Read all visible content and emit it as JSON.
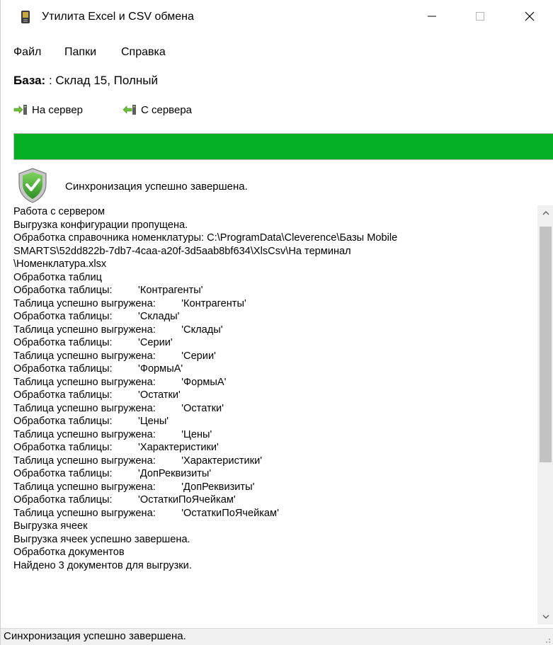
{
  "window": {
    "title": "Утилита Excel и CSV обмена"
  },
  "menu": {
    "items": [
      "Файл",
      "Папки",
      "Справка"
    ]
  },
  "database": {
    "label": "База:",
    "value": " : Склад 15, Полный"
  },
  "toolbar": {
    "to_server_label": "На сервер",
    "from_server_label": "С сервера"
  },
  "progress": {
    "percent": 100,
    "color": "#06b025"
  },
  "status": {
    "message": "Синхронизация успешно завершена."
  },
  "log": {
    "lines": [
      "Работа с сервером",
      "Выгрузка конфигурации пропущена.",
      "Обработка справочника номенклатуры: C:\\ProgramData\\Cleverence\\Базы Mobile",
      "SMARTS\\52dd822b-7db7-4caa-a20f-3d5aab8bf634\\XlsCsv\\На терминал",
      "\\Номенклатура.xlsx",
      "Обработка таблиц",
      "Обработка таблицы:         'Контрагенты'",
      "Таблица успешно выгружена:         'Контрагенты'",
      "Обработка таблицы:         'Склады'",
      "Таблица успешно выгружена:         'Склады'",
      "Обработка таблицы:         'Серии'",
      "Таблица успешно выгружена:         'Серии'",
      "Обработка таблицы:         'ФормыА'",
      "Таблица успешно выгружена:         'ФормыА'",
      "Обработка таблицы:         'Остатки'",
      "Таблица успешно выгружена:         'Остатки'",
      "Обработка таблицы:         'Цены'",
      "Таблица успешно выгружена:         'Цены'",
      "Обработка таблицы:         'Характеристики'",
      "Таблица успешно выгружена:         'Характеристики'",
      "Обработка таблицы:         'ДопРеквизиты'",
      "Таблица успешно выгружена:         'ДопРеквизиты'",
      "Обработка таблицы:         'ОстаткиПоЯчейкам'",
      "Таблица успешно выгружена:         'ОстаткиПоЯчейкам'",
      "Выгрузка ячеек",
      "Выгрузка ячеек успешно завершена.",
      "Обработка документов",
      "Найдено 3 документов для выгрузки."
    ]
  },
  "statusbar": {
    "text": "Синхронизация успешно завершена."
  },
  "icons": {
    "app": "device-icon",
    "to_server": "arrow-right-to-server-icon",
    "from_server": "arrow-left-from-server-icon",
    "status": "shield-check-icon"
  }
}
